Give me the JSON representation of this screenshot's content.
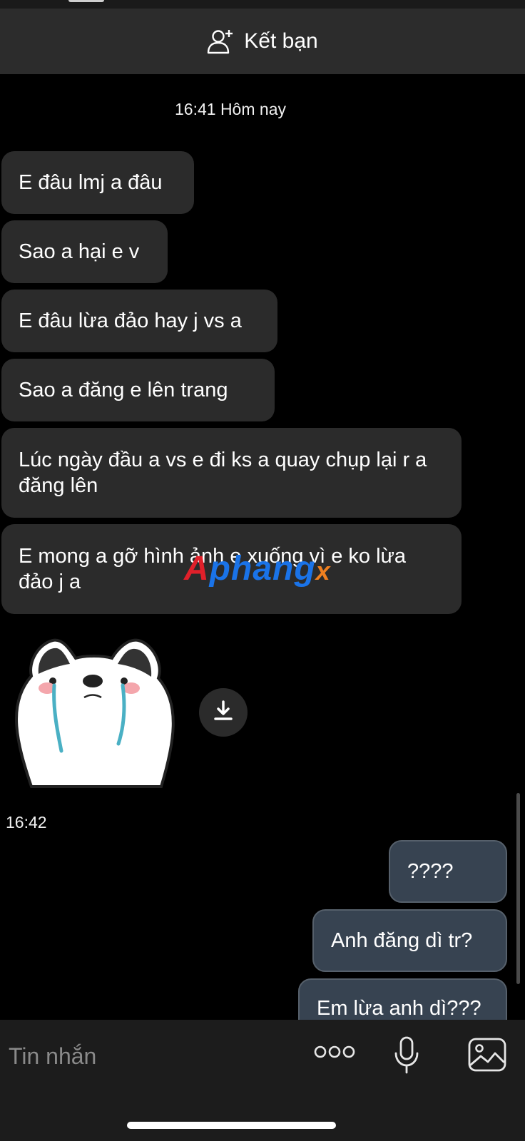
{
  "header": {
    "add_friend_label": "Kết bạn",
    "icon": "add-person-icon"
  },
  "timestamps": {
    "first": "16:41 Hôm nay",
    "second": "16:42"
  },
  "messages_incoming": [
    "E đâu lmj a đâu",
    "Sao a hại e v",
    "E đâu lừa đảo hay j vs a",
    "Sao a đăng e lên trang",
    "Lúc ngày đầu a vs e đi ks a quay chụp lại r a đăng lên",
    "E mong a gỡ hình ảnh e xuống  vì e ko lừa đảo j a"
  ],
  "sticker": {
    "description_icon": "crying-husky-sticker",
    "download_icon": "download-icon"
  },
  "messages_outgoing": [
    "????",
    "Anh đăng dì tr?",
    "Em lừa anh dì???"
  ],
  "watermark": {
    "part1": "A",
    "part2": "phang",
    "part3": "x"
  },
  "input": {
    "placeholder": "Tin nhắn",
    "icons": [
      "more-icon",
      "microphone-icon",
      "photo-icon"
    ]
  },
  "colors": {
    "background": "#000000",
    "incoming_bubble": "#2b2b2b",
    "outgoing_bubble": "#374351",
    "header": "#2c2c2c"
  }
}
